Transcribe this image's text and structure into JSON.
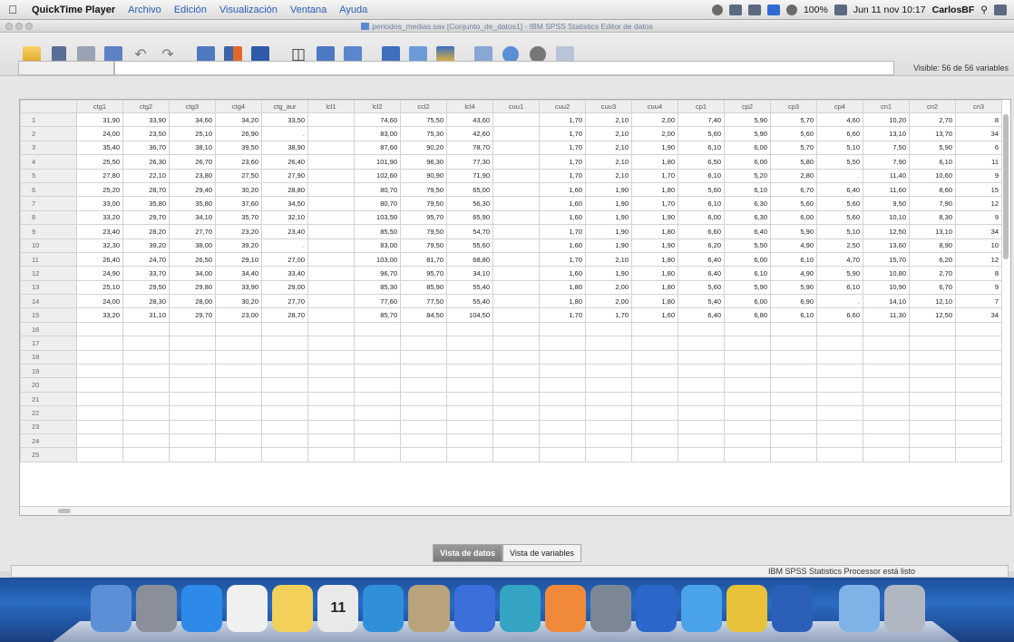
{
  "menubar": {
    "app": "QuickTime Player",
    "items": [
      "Archivo",
      "Edición",
      "Visualización",
      "Ventana",
      "Ayuda"
    ],
    "status_right": {
      "battery": "100%",
      "clock": "Jun 11 nov 10:17",
      "user": "CarlosBF"
    }
  },
  "window": {
    "title": "periodos_medias.sav [Conjunto_de_datos1] - IBM SPSS Statistics Editor de datos"
  },
  "toolbar": {
    "icons": [
      "open-icon",
      "save-icon",
      "print-icon",
      "recall-dialog-icon",
      "undo-icon",
      "redo-icon",
      "goto-case-icon",
      "goto-variable-icon",
      "variables-icon",
      "find-icon",
      "insert-cases-icon",
      "insert-variable-icon",
      "split-file-icon",
      "weight-cases-icon",
      "select-cases-icon",
      "value-labels-icon",
      "use-sets-icon",
      "show-all-variables-icon",
      "spell-check-icon"
    ]
  },
  "cellbar": {
    "visible": "Visible: 56 de 56 variables"
  },
  "grid": {
    "columns": [
      "ctg1",
      "ctg2",
      "ctg3",
      "ctg4",
      "ctg_aur",
      "lcl1",
      "lcl2",
      "ccl2",
      "lcl4",
      "cuu1",
      "cuu2",
      "cuu3",
      "cuu4",
      "cp1",
      "cp2",
      "cp3",
      "cp4",
      "cn1",
      "cn2",
      "cn3"
    ],
    "rows": [
      [
        "31,90",
        "33,90",
        "34,60",
        "34,20",
        "33,50",
        "",
        "74,60",
        "75,50",
        "43,60",
        "",
        "1,70",
        "2,10",
        "2,00",
        "7,40",
        "5,90",
        "5,70",
        "4,60",
        "10,20",
        "2,70",
        "8"
      ],
      [
        "24,00",
        "23,50",
        "25,10",
        "26,90",
        ".",
        "",
        "83,00",
        "75,30",
        "42,60",
        "",
        "1,70",
        "2,10",
        "2,00",
        "5,60",
        "5,90",
        "5,60",
        "6,60",
        "13,10",
        "13,70",
        "34"
      ],
      [
        "35,40",
        "36,70",
        "38,10",
        "39,50",
        "38,90",
        "",
        "87,60",
        "90,20",
        "78,70",
        "",
        "1,70",
        "2,10",
        "1,90",
        "6,10",
        "6,00",
        "5,70",
        "5,10",
        "7,50",
        "5,90",
        "6"
      ],
      [
        "25,50",
        "26,30",
        "26,70",
        "23,60",
        "26,40",
        "",
        "101,90",
        "96,30",
        "77,30",
        "",
        "1,70",
        "2,10",
        "1,80",
        "6,50",
        "6,00",
        "5,80",
        "5,50",
        "7,90",
        "6,10",
        "11"
      ],
      [
        "27,80",
        "22,10",
        "23,80",
        "27,50",
        "27,90",
        "",
        "102,60",
        "90,90",
        "71,90",
        "",
        "1,70",
        "2,10",
        "1,70",
        "6,10",
        "5,20",
        "2,80",
        ".",
        "11,40",
        "10,60",
        "9"
      ],
      [
        "25,20",
        "28,70",
        "29,40",
        "30,20",
        "28,80",
        "",
        "80,70",
        "79,50",
        "65,00",
        "",
        "1,60",
        "1,90",
        "1,80",
        "5,60",
        "6,10",
        "6,70",
        "6,40",
        "11,60",
        "8,60",
        "15"
      ],
      [
        "33,00",
        "35,80",
        "35,80",
        "37,60",
        "34,50",
        "",
        "80,70",
        "79,50",
        "56,30",
        "",
        "1,60",
        "1,90",
        "1,70",
        "6,10",
        "6,30",
        "5,60",
        "5,60",
        "9,50",
        "7,90",
        "12"
      ],
      [
        "33,20",
        "29,70",
        "34,10",
        "35,70",
        "32,10",
        "",
        "103,50",
        "95,70",
        "65,90",
        "",
        "1,60",
        "1,90",
        "1,90",
        "6,00",
        "6,30",
        "6,00",
        "5,60",
        "10,10",
        "8,30",
        "9"
      ],
      [
        "23,40",
        "28,20",
        "27,70",
        "23,20",
        "23,40",
        "",
        "85,50",
        "79,50",
        "54,70",
        "",
        "1,70",
        "1,90",
        "1,80",
        "6,60",
        "6,40",
        "5,90",
        "5,10",
        "12,50",
        "13,10",
        "34"
      ],
      [
        "32,30",
        "39,20",
        "38,00",
        "39,20",
        ".",
        "",
        "83,00",
        "79,50",
        "55,60",
        "",
        "1,60",
        "1,90",
        "1,90",
        "6,20",
        "5,50",
        "4,90",
        "2,50",
        "13,60",
        "8,90",
        "10"
      ],
      [
        "26,40",
        "24,70",
        "26,50",
        "29,10",
        "27,00",
        "",
        "103,00",
        "81,70",
        "68,80",
        "",
        "1,70",
        "2,10",
        "1,80",
        "6,40",
        "6,00",
        "6,10",
        "4,70",
        "15,70",
        "6,20",
        "12"
      ],
      [
        "24,90",
        "33,70",
        "34,00",
        "34,40",
        "33,40",
        "",
        "96,70",
        "95,70",
        "34,10",
        "",
        "1,60",
        "1,90",
        "1,80",
        "6,40",
        "6,10",
        "4,90",
        "5,90",
        "10,80",
        "2,70",
        "8"
      ],
      [
        "25,10",
        "29,50",
        "29,80",
        "33,90",
        "29,00",
        "",
        "85,30",
        "85,90",
        "55,40",
        "",
        "1,80",
        "2,00",
        "1,80",
        "5,60",
        "5,90",
        "5,90",
        "6,10",
        "10,90",
        "6,70",
        "9"
      ],
      [
        "24,00",
        "28,30",
        "28,00",
        "30,20",
        "27,70",
        "",
        "77,60",
        "77,50",
        "55,40",
        "",
        "1,80",
        "2,00",
        "1,80",
        "5,40",
        "6,00",
        "6,90",
        ".",
        "14,10",
        "12,10",
        "7"
      ],
      [
        "33,20",
        "31,10",
        "29,70",
        "23,00",
        "28,70",
        "",
        "85,70",
        "84,50",
        "104,50",
        "",
        "1,70",
        "1,70",
        "1,60",
        "6,40",
        "6,80",
        "6,10",
        "6,60",
        "11,30",
        "12,50",
        "34"
      ]
    ],
    "empty_row_count": 10
  },
  "tabs": {
    "data_view": "Vista de datos",
    "variable_view": "Vista de variables"
  },
  "statusbar": {
    "text": "IBM SPSS Statistics Processor está listo"
  },
  "dock": {
    "icons": [
      "finder-icon",
      "launchpad-icon",
      "app-store-icon",
      "reminders-icon",
      "notes-icon",
      "calendar-icon",
      "safari-icon",
      "preview-icon",
      "itunes-icon",
      "image-capture-icon",
      "pages-icon",
      "system-preferences-icon",
      "word-icon",
      "spss-icon",
      "game-icon",
      "quicktime-icon",
      "folder-icon",
      "trash-icon"
    ],
    "calendar_day": "11"
  }
}
